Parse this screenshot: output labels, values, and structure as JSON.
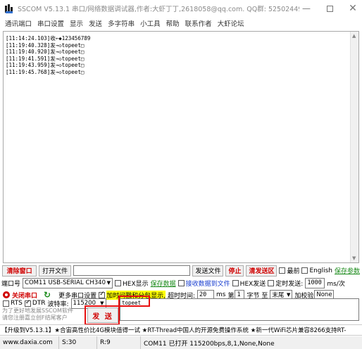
{
  "window": {
    "title": "SSCOM V5.13.1 串口/网络数据调试器,作者:大虾丁丁,2618058@qq.com. QQ群: 52502449(..."
  },
  "menu": [
    "通讯端口",
    "串口设置",
    "显示",
    "发送",
    "多字符串",
    "小工具",
    "帮助",
    "联系作者",
    "大虾论坛"
  ],
  "receive_log": [
    "[11:14:24.103]收←◆123456789",
    "[11:19:40.328]发→◇topeet□",
    "[11:19:40.920]发→◇topeet□",
    "[11:19:41.591]发→◇topeet□",
    "[11:19:43.959]发→◇topeet□",
    "[11:19:45.768]发→◇topeet□"
  ],
  "row1": {
    "clear_window": "清除窗口",
    "open_file": "打开文件",
    "send_file": "发送文件",
    "stop": "停止",
    "clear_send": "清发送区",
    "latest": "最前",
    "english": "English",
    "save_parameters": "保存参数"
  },
  "row2": {
    "port_label": "端口号",
    "port_value": "COM11 USB-SERIAL CH340",
    "hex_display": "HEX显示",
    "save_data": "保存数据",
    "receive_to_file": "接收数据到文件",
    "hex_send": "HEX发送",
    "timed_send": "定时发送:",
    "interval_value": "1000",
    "interval_unit": "ms/次"
  },
  "row3": {
    "close_port": "关闭串口",
    "more_settings": "更多串口设置",
    "timestamp_packet": "加时间戳和分包显示,",
    "timeout_label": "超时时间:",
    "timeout_value": "20",
    "timeout_unit": "ms",
    "byte_label_prefix": "第",
    "byte_start": "1",
    "byte_label_mid": "字节 至",
    "byte_end": "末尾",
    "checksum_label": "加校验",
    "checksum_value": "None"
  },
  "row4": {
    "rts": "RTS",
    "dtr": "DTR",
    "baud_label": "波特率:",
    "baud_value": "115200"
  },
  "send_text": "topeet",
  "send_button": "发 送",
  "promo_lines": [
    "为了更好地发展SSCOM软件",
    "请您注册嘉立创F结尾客户"
  ],
  "ticker": "【升级到V5.13.1】★合宙高性价比4G模块值得一试 ★RT-Thread中国人的开源免费操作系统 ★新一代WiFi芯片兼容8266支持RT-",
  "status": {
    "website": "www.daxia.com",
    "s_count": "S:30",
    "r_count": "R:9",
    "port_status": "COM11 已打开  115200bps,8,1,None,None"
  }
}
